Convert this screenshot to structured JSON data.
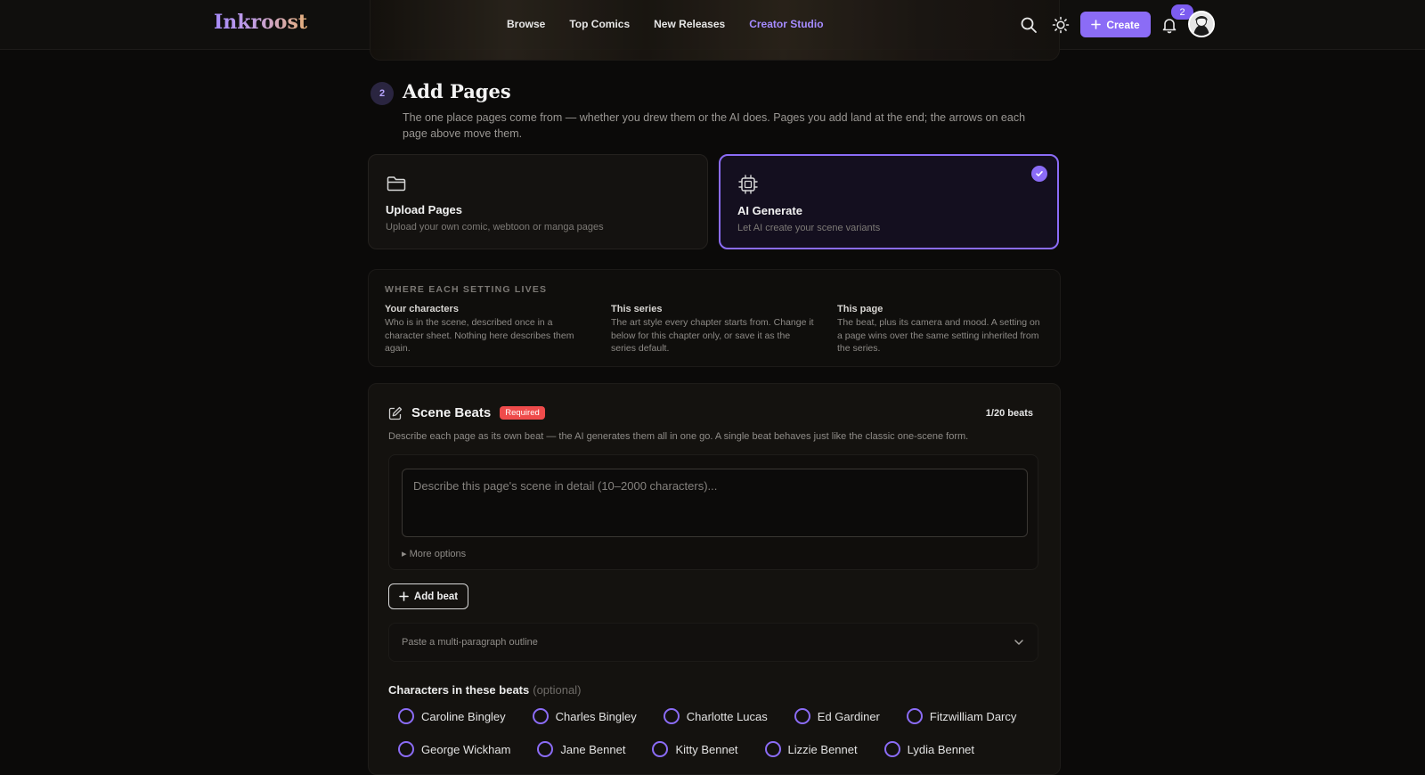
{
  "app": {
    "logo": "Inkroost",
    "nav": [
      "Browse",
      "Top Comics",
      "New Releases",
      "Creator Studio"
    ],
    "create_label": "Create",
    "notification_count": "2"
  },
  "section": {
    "step_number": "2",
    "title": "Add Pages",
    "description": "The one place pages come from — whether you drew them or the AI does. Pages you add land at the end; the arrows on each page above move them."
  },
  "modes": {
    "upload": {
      "title": "Upload Pages",
      "subtitle": "Upload your own comic, webtoon or manga pages",
      "selected": false
    },
    "ai": {
      "title": "AI Generate",
      "subtitle": "Let AI create your scene variants",
      "selected": true
    }
  },
  "settings": {
    "heading": "WHERE EACH SETTING LIVES",
    "columns": [
      {
        "title": "Your characters",
        "text": "Who is in the scene, described once in a character sheet. Nothing here describes them again."
      },
      {
        "title": "This series",
        "text": "The art style every chapter starts from. Change it below for this chapter only, or save it as the series default."
      },
      {
        "title": "This page",
        "text": "The beat, plus its camera and mood. A setting on a page wins over the same setting inherited from the series."
      }
    ]
  },
  "beats": {
    "title": "Scene Beats",
    "required": "Required",
    "count": "1/20 beats",
    "description": "Describe each page as its own beat — the AI generates them all in one go. A single beat behaves just like the classic one-scene form.",
    "placeholder": "Describe this page's scene in detail (10–2000 characters)...",
    "more_options": "▸ More options",
    "add_beat": "Add beat",
    "outline_label": "Paste a multi-paragraph outline"
  },
  "characters": {
    "heading": "Characters in these beats",
    "optional": "(optional)",
    "row1": [
      "Caroline Bingley",
      "Charles Bingley",
      "Charlotte Lucas",
      "Ed Gardiner",
      "Fitzwilliam Darcy"
    ],
    "row2": [
      "George Wickham",
      "Jane Bennet",
      "Kitty Bennet",
      "Lizzie Bennet",
      "Lydia Bennet"
    ]
  },
  "colors": {
    "accent": "#8b6cf6",
    "required": "#ef4b4b",
    "background": "#0b0a09"
  }
}
